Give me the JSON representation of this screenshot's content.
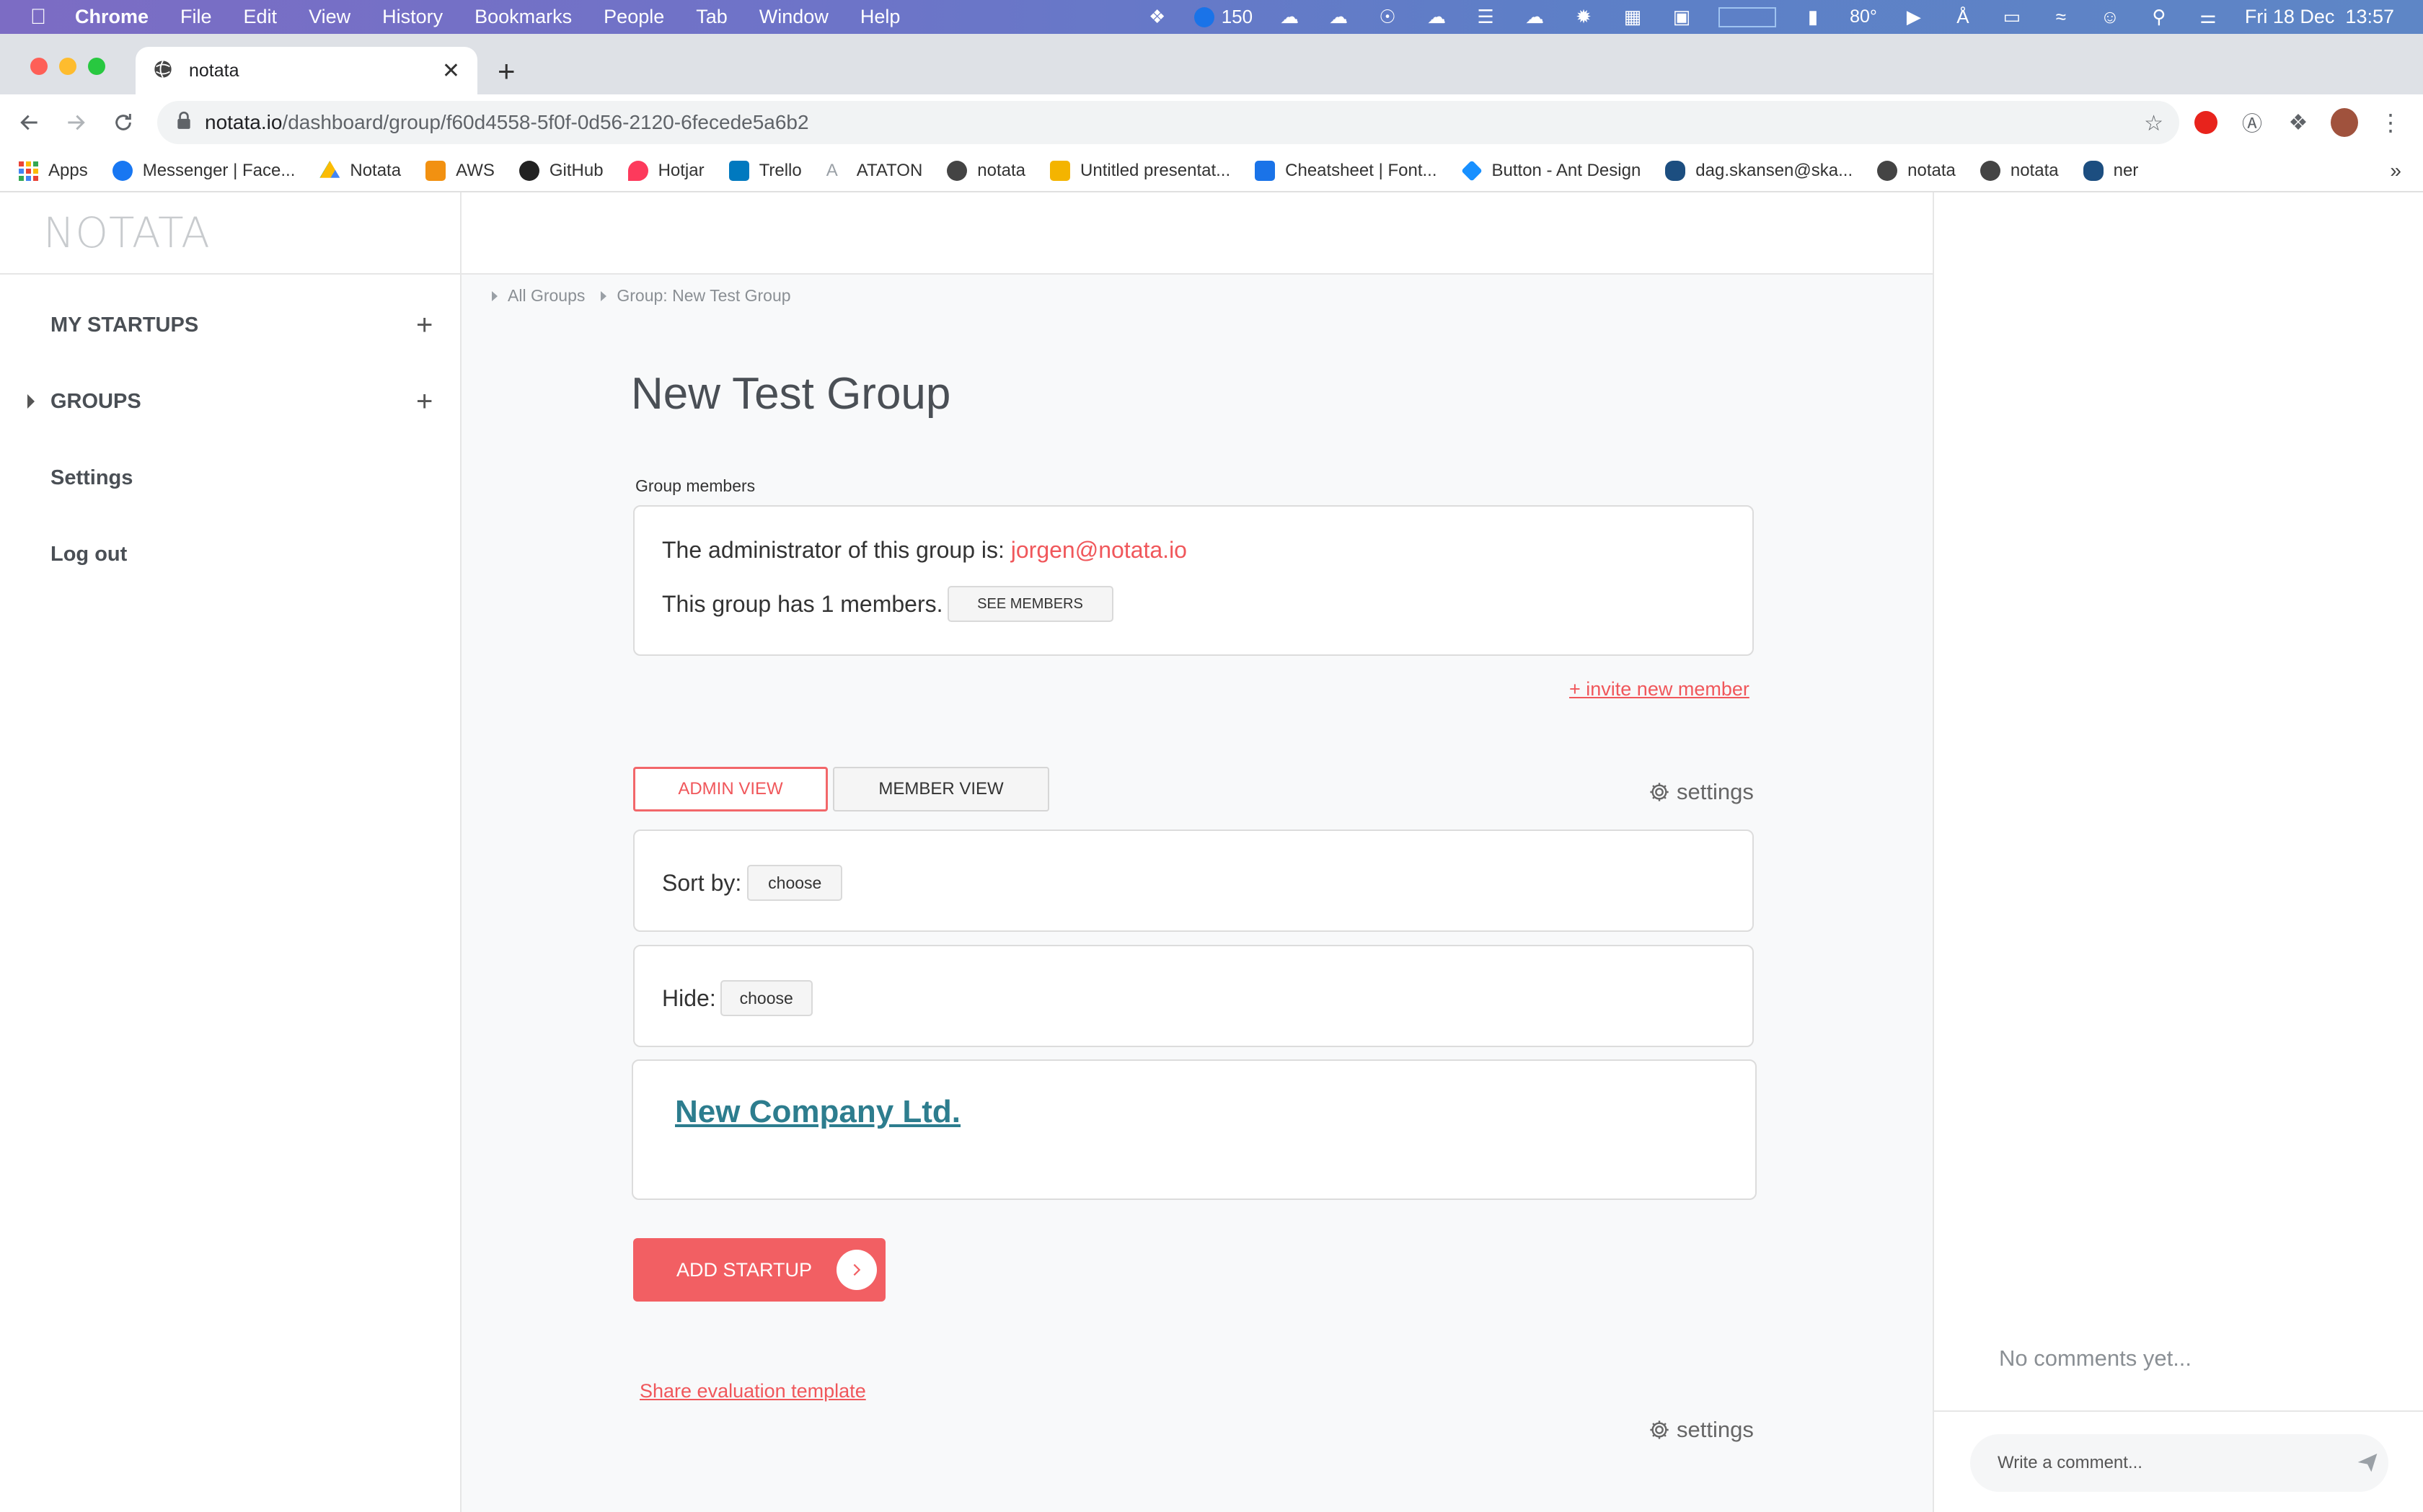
{
  "menubar": {
    "items": [
      "Chrome",
      "File",
      "Edit",
      "View",
      "History",
      "Bookmarks",
      "People",
      "Tab",
      "Window",
      "Help"
    ],
    "counter": "150",
    "temp": "80°",
    "datetime": "Fri 18 Dec  13:57"
  },
  "browser": {
    "tab_title": "notata",
    "url_host": "notata.io",
    "url_path": "/dashboard/group/f60d4558-5f0f-0d56-2120-6fecede5a6b2"
  },
  "bookmarks": [
    {
      "label": "Apps",
      "color": "#e84335"
    },
    {
      "label": "Messenger | Face...",
      "color": "#1877f2"
    },
    {
      "label": "Notata",
      "color": "#fbbc04"
    },
    {
      "label": "AWS",
      "color": "#f29111"
    },
    {
      "label": "GitHub",
      "color": "#222222"
    },
    {
      "label": "Hotjar",
      "color": "#fd3a5c"
    },
    {
      "label": "Trello",
      "color": "#0079bf"
    },
    {
      "label": "ATATON",
      "color": "#9aa0a6"
    },
    {
      "label": "notata",
      "color": "#444444"
    },
    {
      "label": "Untitled presentat...",
      "color": "#f4b400"
    },
    {
      "label": "Cheatsheet | Font...",
      "color": "#1a73e8"
    },
    {
      "label": "Button - Ant Design",
      "color": "#1890ff"
    },
    {
      "label": "dag.skansen@ska...",
      "color": "#1c4e80"
    },
    {
      "label": "notata",
      "color": "#444444"
    },
    {
      "label": "notata",
      "color": "#444444"
    },
    {
      "label": "ner",
      "color": "#1c4e80"
    }
  ],
  "sidebar": {
    "logo": "NOTATA",
    "my_startups": "MY STARTUPS",
    "groups": "GROUPS",
    "settings": "Settings",
    "logout": "Log out"
  },
  "breadcrumb": {
    "all_groups": "All Groups",
    "current": "Group: New Test Group"
  },
  "page": {
    "title": "New Test Group",
    "members_label": "Group members",
    "admin_prefix": "The administrator of this group is:",
    "admin_email": "jorgen@notata.io",
    "members_count_text": "This group has 1 members.",
    "see_members": "SEE MEMBERS",
    "invite": "+ invite new member",
    "admin_view": "ADMIN VIEW",
    "member_view": "MEMBER VIEW",
    "settings": "settings",
    "sort_label": "Sort by:",
    "sort_value": "choose",
    "hide_label": "Hide:",
    "hide_value": "choose",
    "company": "New Company Ltd.",
    "add_startup": "ADD STARTUP",
    "share_template": "Share evaluation template",
    "settings_bottom": "settings"
  },
  "comments": {
    "empty": "No comments yet...",
    "placeholder": "Write a comment..."
  },
  "colors": {
    "accent": "#f0575b",
    "company_link": "#2d7d8e"
  }
}
